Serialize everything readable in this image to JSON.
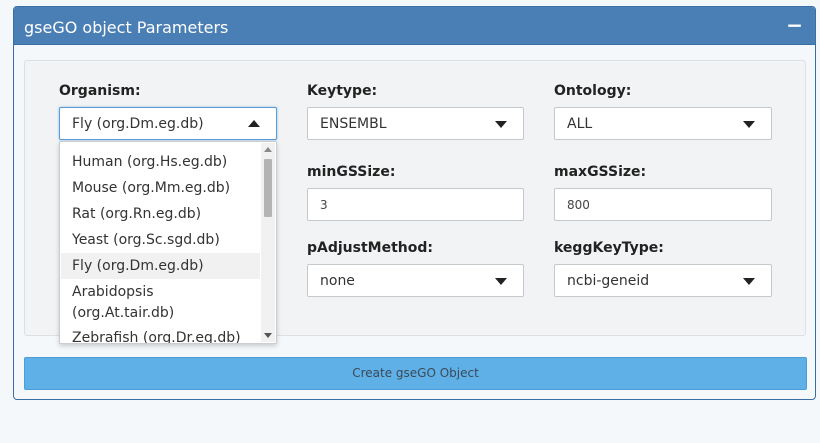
{
  "panel": {
    "title": "gseGO object Parameters",
    "collapse_symbol": "−"
  },
  "organism": {
    "label": "Organism:",
    "value": "Fly (org.Dm.eg.db)",
    "options": [
      "Human (org.Hs.eg.db)",
      "Mouse (org.Mm.eg.db)",
      "Rat (org.Rn.eg.db)",
      "Yeast (org.Sc.sgd.db)",
      "Fly (org.Dm.eg.db)",
      "Arabidopsis",
      "(org.At.tair.db)",
      "Zebrafish (org.Dr.eg.db)"
    ]
  },
  "keytype": {
    "label": "Keytype:",
    "value": "ENSEMBL"
  },
  "ontology": {
    "label": "Ontology:",
    "value": "ALL"
  },
  "minGSSize": {
    "label": "minGSSize:",
    "value": "3"
  },
  "maxGSSize": {
    "label": "maxGSSize:",
    "value": "800"
  },
  "pAdjustMethod": {
    "label": "pAdjustMethod:",
    "value": "none"
  },
  "keggKeyType": {
    "label": "keggKeyType:",
    "value": "ncbi-geneid"
  },
  "create_button": {
    "label": "Create gseGO Object"
  },
  "colors": {
    "header": "#4a7fb5",
    "button": "#5fb0e6",
    "well": "#f1f3f4"
  }
}
